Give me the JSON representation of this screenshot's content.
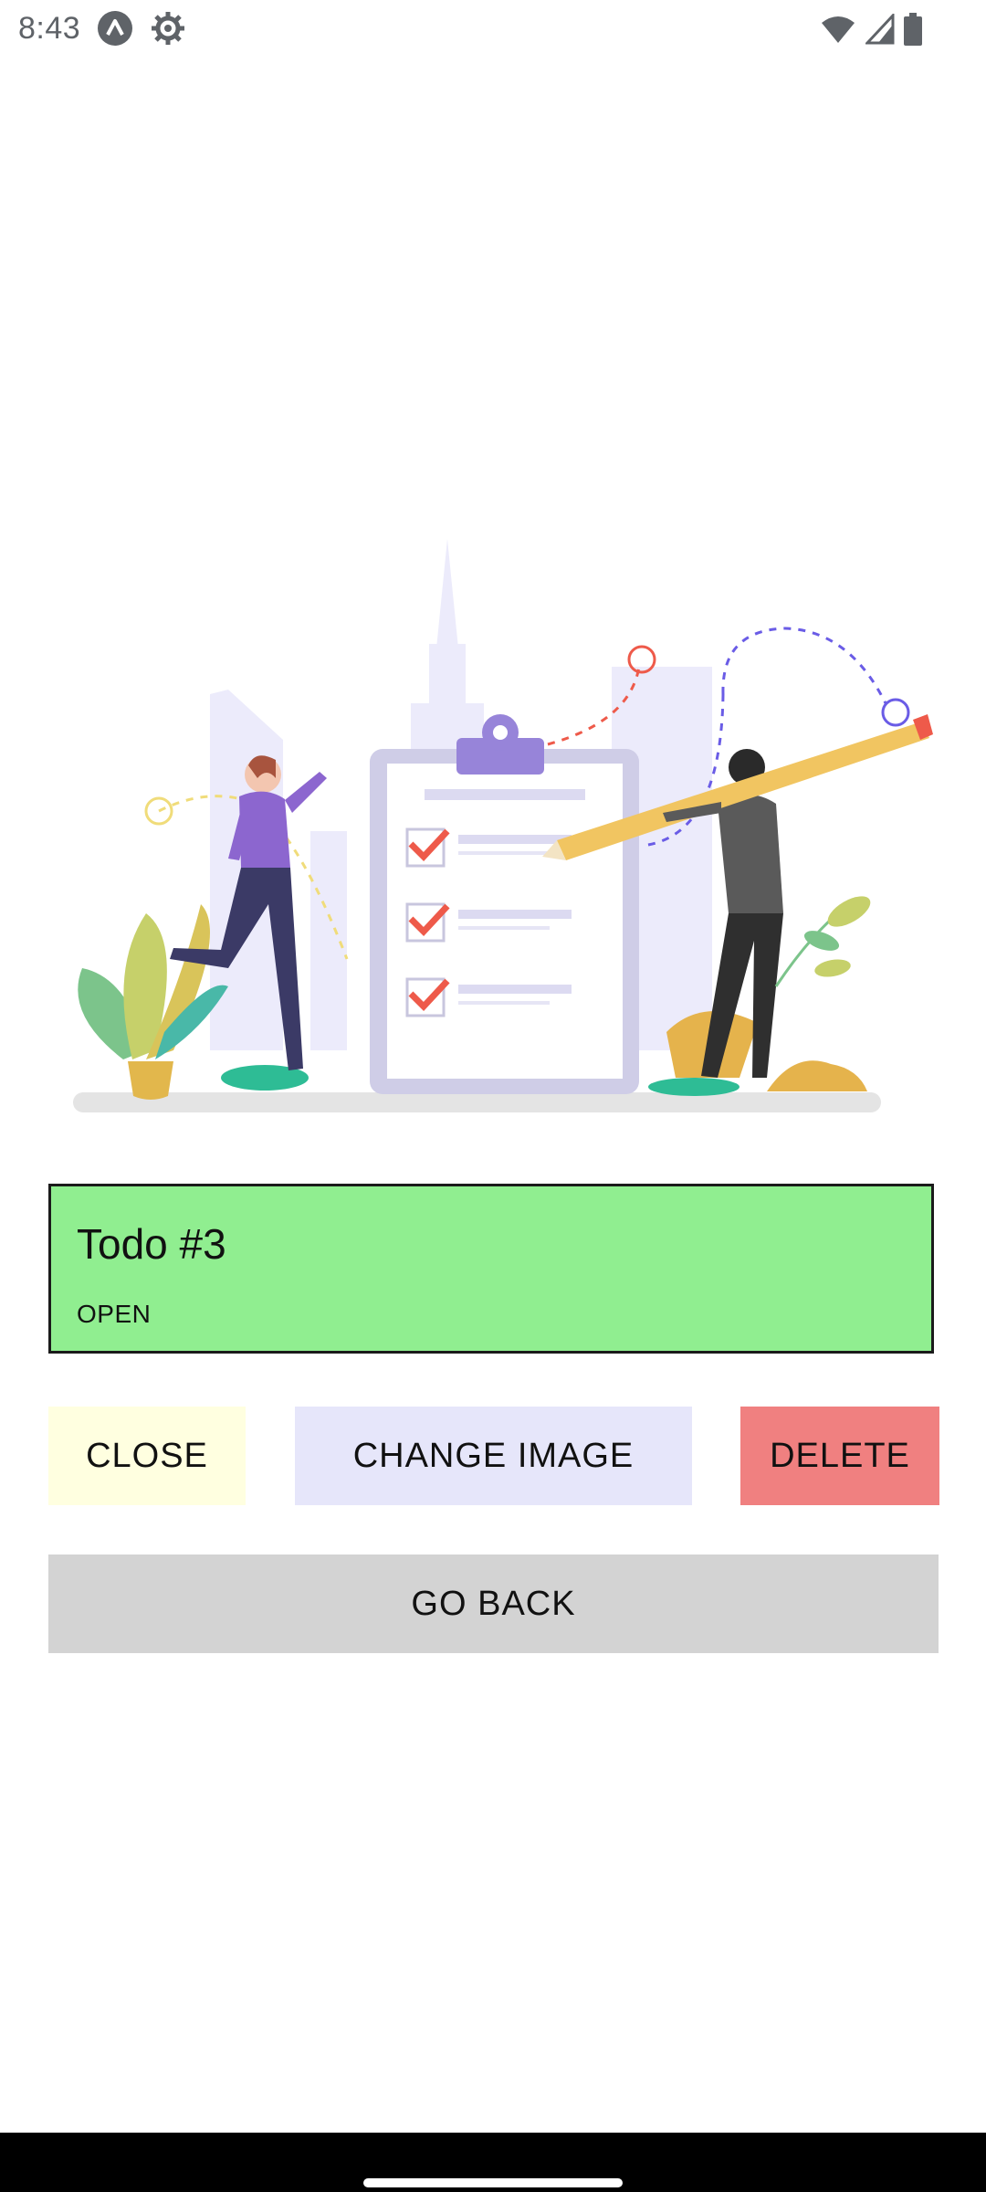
{
  "status_bar": {
    "time": "8:43",
    "icons": [
      "app-notification-icon",
      "settings-gear-icon",
      "wifi-icon",
      "cellular-signal-icon",
      "battery-icon"
    ]
  },
  "illustration": {
    "description_icon": "todo-checklist-illustration"
  },
  "todo": {
    "title": "Todo #3",
    "status": "OPEN",
    "card_color": "#90ee90"
  },
  "actions": {
    "close_label": "CLOSE",
    "change_image_label": "CHANGE IMAGE",
    "delete_label": "DELETE",
    "go_back_label": "GO BACK"
  },
  "colors": {
    "close_bg": "#ffffe0",
    "change_image_bg": "#e6e6fa",
    "delete_bg": "#f08080",
    "go_back_bg": "#d3d3d3"
  }
}
